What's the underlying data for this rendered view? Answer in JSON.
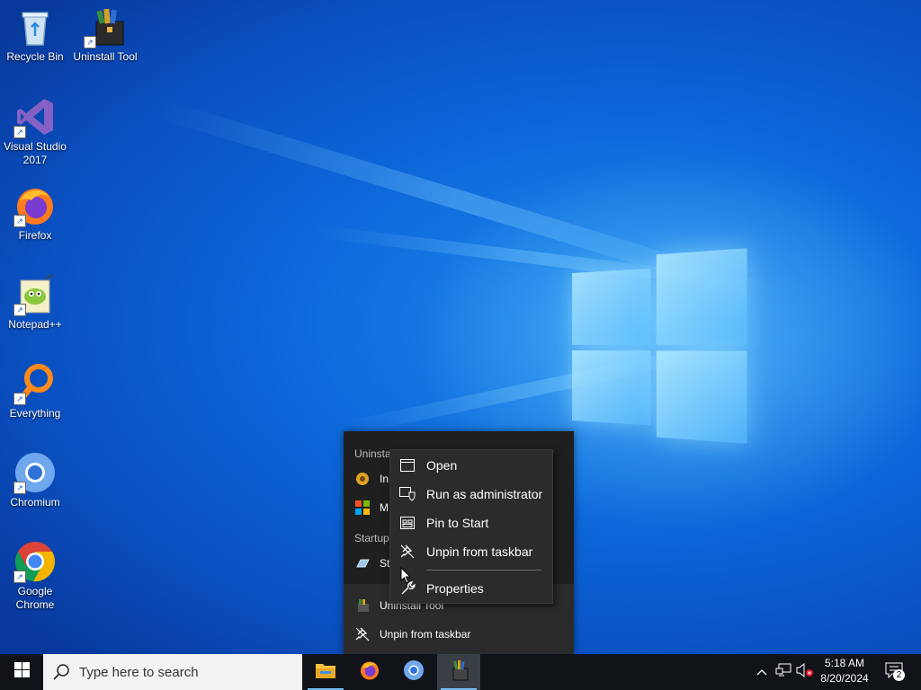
{
  "desktop": {
    "icons": [
      {
        "label": "Recycle Bin",
        "icon": "recycle-bin-icon"
      },
      {
        "label": "Uninstall Tool",
        "icon": "uninstall-tool-icon"
      },
      {
        "label": "Visual Studio 2017",
        "icon": "visual-studio-icon"
      },
      {
        "label": "Firefox",
        "icon": "firefox-icon"
      },
      {
        "label": "Notepad++",
        "icon": "notepad-plus-plus-icon"
      },
      {
        "label": "Everything",
        "icon": "everything-search-icon"
      },
      {
        "label": "Chromium",
        "icon": "chromium-icon"
      },
      {
        "label": "Google Chrome",
        "icon": "google-chrome-icon"
      }
    ]
  },
  "jumplist": {
    "section_uninstall": "Uninsta",
    "item_1": "In",
    "item_2": "M",
    "section_startup": "Startup",
    "item_3": "St",
    "app_name": "Uninstall Tool",
    "unpin": "Unpin from taskbar"
  },
  "context_menu": {
    "items": [
      {
        "label": "Open",
        "icon": "window-icon"
      },
      {
        "label": "Run as administrator",
        "icon": "shield-icon"
      },
      {
        "label": "Pin to Start",
        "icon": "pin-start-icon"
      },
      {
        "label": "Unpin from taskbar",
        "icon": "unpin-icon"
      },
      {
        "label": "Properties",
        "icon": "wrench-icon"
      }
    ]
  },
  "taskbar": {
    "search_placeholder": "Type here to search",
    "apps": [
      {
        "name": "File Explorer",
        "icon": "folder-icon"
      },
      {
        "name": "Firefox",
        "icon": "firefox-icon"
      },
      {
        "name": "Chromium",
        "icon": "chromium-icon"
      },
      {
        "name": "Uninstall Tool",
        "icon": "uninstall-tool-icon"
      }
    ],
    "time": "5:18 AM",
    "date": "8/20/2024",
    "notification_count": "2"
  },
  "colors": {
    "taskbar_bg": "#101418",
    "menu_bg": "#2b2b2b",
    "jumplist_bg": "#1f1f1f",
    "accent": "#76b9ed",
    "wallpaper_blue": "#0c66d8"
  }
}
